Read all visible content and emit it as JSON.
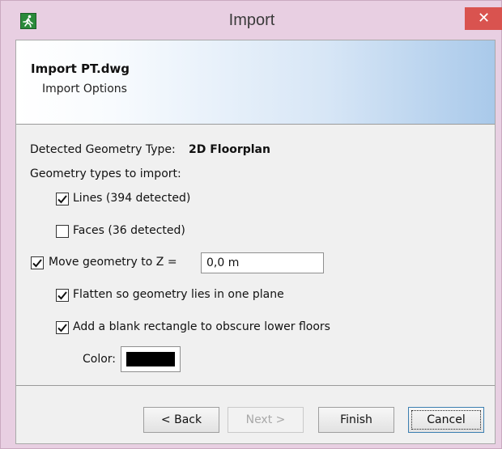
{
  "window": {
    "title": "Import"
  },
  "titlebar": {
    "close_glyph": "✕",
    "app_icon": "running-man-icon"
  },
  "banner": {
    "title": "Import PT.dwg",
    "subtitle": "Import Options"
  },
  "geometry": {
    "detected_label": "Detected Geometry Type:",
    "detected_value": "2D Floorplan",
    "types_label": "Geometry types to import:",
    "lines_label": "Lines (394 detected)",
    "lines_checked": true,
    "faces_label": "Faces (36 detected)",
    "faces_checked": false
  },
  "move": {
    "label": "Move geometry to Z =",
    "checked": true,
    "z_value": "0,0 m",
    "flatten_label": "Flatten so geometry lies in one plane",
    "flatten_checked": true,
    "blank_label": "Add a blank rectangle to obscure lower floors",
    "blank_checked": true,
    "color_label": "Color:",
    "color_value": "#000000"
  },
  "buttons": {
    "back": "< Back",
    "next": "Next >",
    "finish": "Finish",
    "cancel": "Cancel"
  }
}
